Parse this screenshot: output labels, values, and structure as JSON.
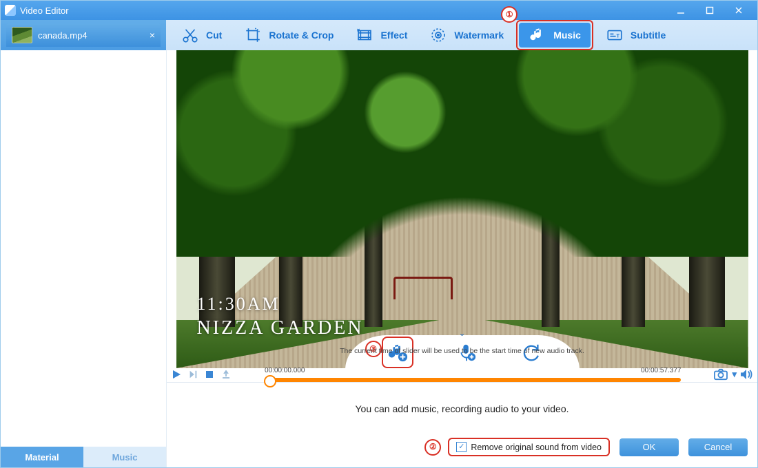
{
  "titlebar": {
    "caption": "Video Editor"
  },
  "file_tab": {
    "name": "canada.mp4"
  },
  "toolbar": {
    "items": [
      {
        "key": "cut",
        "label": "Cut"
      },
      {
        "key": "rotate",
        "label": "Rotate & Crop"
      },
      {
        "key": "effect",
        "label": "Effect"
      },
      {
        "key": "watermark",
        "label": "Watermark"
      },
      {
        "key": "music",
        "label": "Music"
      },
      {
        "key": "subtitle",
        "label": "Subtitle"
      }
    ],
    "active": "music"
  },
  "sidebar_tabs": {
    "material": "Material",
    "music": "Music",
    "active": "material"
  },
  "preview": {
    "overlay_line1": "11:30AM",
    "overlay_line2": "NIZZA GARDEN"
  },
  "timeline": {
    "start": "00:00:00.000",
    "end": "00:00:57.377",
    "hint": "The current time of slider will be used to be the start time of new audio track."
  },
  "bottom": {
    "message": "You can add music, recording audio to your video.",
    "checkbox_label": "Remove original sound from video",
    "checkbox_checked": true,
    "ok": "OK",
    "cancel": "Cancel"
  },
  "callouts": {
    "c1": "①",
    "c2": "②",
    "c3": "③"
  }
}
